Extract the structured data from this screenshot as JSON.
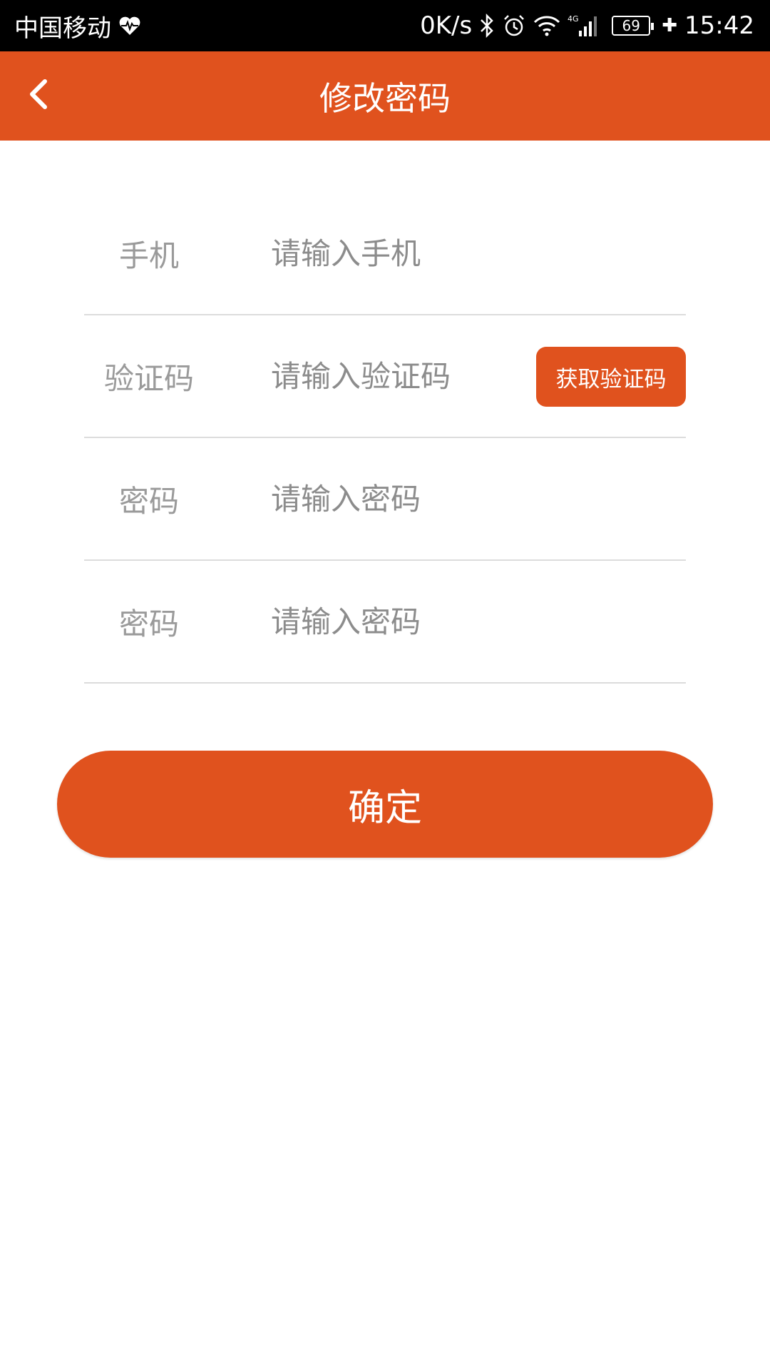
{
  "status_bar": {
    "carrier": "中国移动",
    "net_speed": "0K/s",
    "network_type": "4G",
    "battery": "69",
    "time": "15:42",
    "icons": [
      "heart-rate-icon",
      "bluetooth-icon",
      "alarm-icon",
      "wifi-icon",
      "signal-icon",
      "battery-icon",
      "charging-icon"
    ]
  },
  "header": {
    "title": "修改密码",
    "back_icon": "chevron-left-icon"
  },
  "form": {
    "phone": {
      "label": "手机",
      "placeholder": "请输入手机"
    },
    "code": {
      "label": "验证码",
      "placeholder": "请输入验证码",
      "button_label": "获取验证码"
    },
    "password": {
      "label": "密码",
      "placeholder": "请输入密码"
    },
    "password_confirm": {
      "label": "密码",
      "placeholder": "请输入密码"
    }
  },
  "confirm_label": "确定",
  "colors": {
    "accent": "#E0521E",
    "status_bar_bg": "#000000",
    "divider": "#dcdcdc",
    "label_text": "#9a9a9a"
  }
}
